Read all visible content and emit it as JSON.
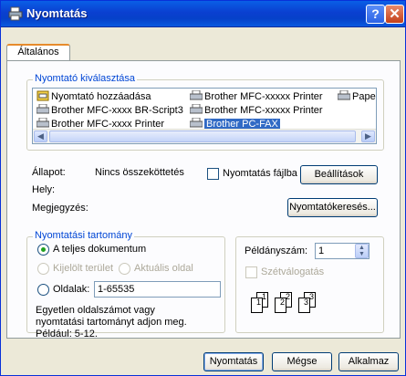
{
  "window": {
    "title": "Nyomtatás",
    "help": "?",
    "close": "✕"
  },
  "tabs": [
    {
      "label": "Általános"
    }
  ],
  "printer_select": {
    "title": "Nyomtató kiválasztása",
    "printers": [
      {
        "label": "Nyomtató hozzáadása"
      },
      {
        "label": "Brother MFC-xxxxx Printer"
      },
      {
        "label": "PaperPo"
      },
      {
        "label": "Brother MFC-xxxx BR-Script3"
      },
      {
        "label": "Brother MFC-xxxxx Printer"
      },
      {
        "label": "Brother MFC-xxxx Printer"
      },
      {
        "label": "Brother PC-FAX"
      }
    ],
    "selected": "Brother PC-FAX"
  },
  "status": {
    "state_label": "Állapot:",
    "state_value": "Nincs összeköttetés",
    "location_label": "Hely:",
    "comment_label": "Megjegyzés:",
    "print_to_file": "Nyomtatás fájlba",
    "settings_button": "Beállítások",
    "find_button": "Nyomtatókeresés..."
  },
  "range": {
    "title": "Nyomtatási tartomány",
    "all": "A teljes dokumentum",
    "selection": "Kijelölt terület",
    "current": "Aktuális oldal",
    "pages": "Oldalak:",
    "pages_value": "1-65535",
    "description": "Egyetlen oldalszámot vagy nyomtatási tartományt adjon meg. Például: 5-12."
  },
  "copies": {
    "label": "Példányszám:",
    "value": "1",
    "collate": "Szétválogatás",
    "pages": [
      "1",
      "1",
      "2",
      "2",
      "3",
      "3"
    ]
  },
  "buttons": {
    "print": "Nyomtatás",
    "cancel": "Mégse",
    "apply": "Alkalmaz"
  }
}
